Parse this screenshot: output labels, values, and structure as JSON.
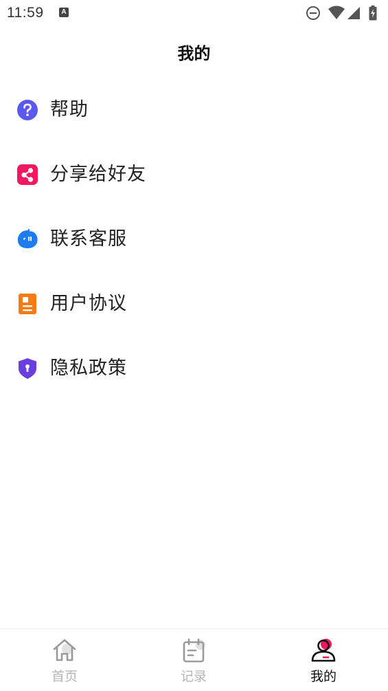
{
  "status_bar": {
    "time": "11:59",
    "notification_letter": "A",
    "icons": [
      "do-not-disturb-icon",
      "wifi-icon",
      "signal-icon",
      "battery-charging-icon"
    ]
  },
  "header": {
    "title": "我的"
  },
  "menu": {
    "items": [
      {
        "label": "帮助",
        "icon": "help-icon",
        "color": "#5b58f0"
      },
      {
        "label": "分享给好友",
        "icon": "share-icon",
        "color": "#f0195f"
      },
      {
        "label": "联系客服",
        "icon": "customer-service-icon",
        "color": "#1e7cf0"
      },
      {
        "label": "用户协议",
        "icon": "user-agreement-icon",
        "color": "#f57c14"
      },
      {
        "label": "隐私政策",
        "icon": "privacy-shield-icon",
        "color": "#6a3fe0"
      }
    ]
  },
  "tab_bar": {
    "tabs": [
      {
        "label": "首页",
        "icon": "home-icon",
        "active": false
      },
      {
        "label": "记录",
        "icon": "record-icon",
        "active": false
      },
      {
        "label": "我的",
        "icon": "profile-icon",
        "active": true
      }
    ],
    "accent_color": "#f0195f",
    "inactive_color": "#b5b5b5"
  }
}
